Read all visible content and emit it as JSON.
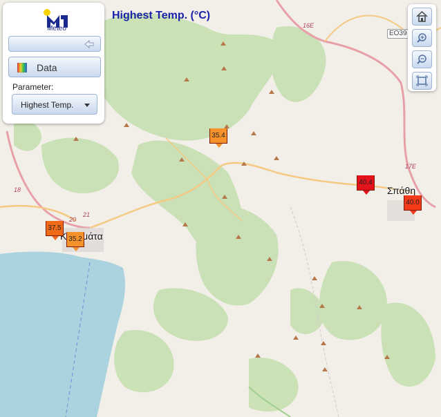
{
  "title": "Highest Temp. (°C)",
  "panel": {
    "logo_text": "Meteo",
    "data_label": "Data",
    "parameter_label": "Parameter:",
    "parameter_value": "Highest Temp."
  },
  "toolbar": {
    "home_icon": "home-icon",
    "zoom_in_icon": "zoom-in-icon",
    "zoom_out_icon": "zoom-out-icon",
    "extent_icon": "full-extent-icon"
  },
  "places": {
    "kalamata": "Καλαμάτα",
    "spatha": "Σπάθη"
  },
  "road_labels": {
    "r16e": "16E",
    "r17e": "17E",
    "r18": "18",
    "r20": "20",
    "r21": "21",
    "eo39": "EO39"
  },
  "stations": [
    {
      "value": "35.4",
      "color": "#f5932a"
    },
    {
      "value": "37.5",
      "color": "#f06a18"
    },
    {
      "value": "35.2",
      "color": "#f5932a"
    },
    {
      "value": "40.4",
      "color": "#e4121a"
    },
    {
      "value": "40.0",
      "color": "#f53a1a"
    }
  ]
}
